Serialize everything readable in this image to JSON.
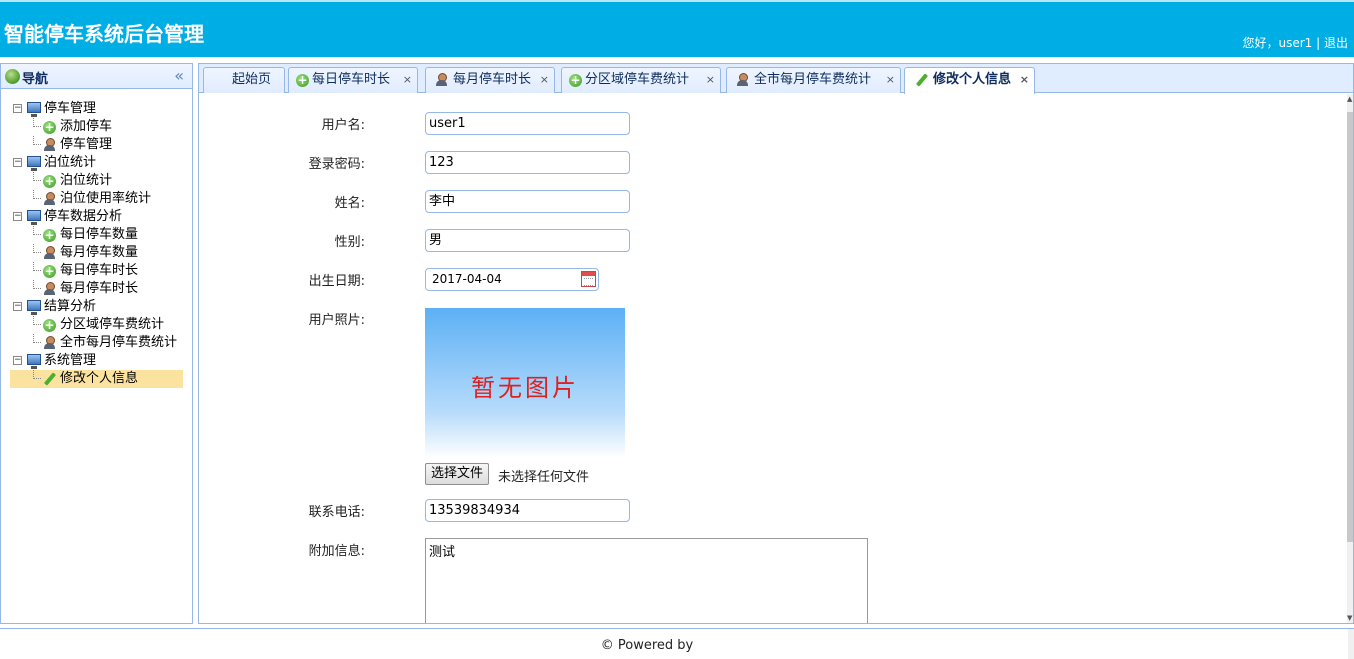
{
  "header": {
    "title": "智能停车系统后台管理",
    "greeting": "您好，user1",
    "separator": "|",
    "logout": "退出"
  },
  "nav": {
    "title": "导航",
    "collapse_glyph": "«",
    "groups": [
      {
        "label": "停车管理",
        "children": [
          {
            "label": "添加停车",
            "icon": "plus-icon"
          },
          {
            "label": "停车管理",
            "icon": "user-icon"
          }
        ]
      },
      {
        "label": "泊位统计",
        "children": [
          {
            "label": "泊位统计",
            "icon": "plus-icon"
          },
          {
            "label": "泊位使用率统计",
            "icon": "user-icon"
          }
        ]
      },
      {
        "label": "停车数据分析",
        "children": [
          {
            "label": "每日停车数量",
            "icon": "plus-icon"
          },
          {
            "label": "每月停车数量",
            "icon": "user-icon"
          },
          {
            "label": "每日停车时长",
            "icon": "plus-icon"
          },
          {
            "label": "每月停车时长",
            "icon": "user-icon"
          }
        ]
      },
      {
        "label": "结算分析",
        "children": [
          {
            "label": "分区域停车费统计",
            "icon": "plus-icon"
          },
          {
            "label": "全市每月停车费统计",
            "icon": "user-icon"
          }
        ]
      },
      {
        "label": "系统管理",
        "children": [
          {
            "label": "修改个人信息",
            "icon": "pencil-icon",
            "selected": true
          }
        ]
      }
    ]
  },
  "tabs": [
    {
      "label": "起始页",
      "closable": false
    },
    {
      "label": "每日停车时长",
      "icon": "plus-icon",
      "closable": true
    },
    {
      "label": "每月停车时长",
      "icon": "user-icon",
      "closable": true
    },
    {
      "label": "分区域停车费统计",
      "icon": "plus-icon",
      "closable": true
    },
    {
      "label": "全市每月停车费统计",
      "icon": "user-icon",
      "closable": true
    },
    {
      "label": "修改个人信息",
      "icon": "pencil-icon",
      "closable": true,
      "active": true
    }
  ],
  "tab_close_glyph": "×",
  "form": {
    "username_label": "用户名:",
    "username_value": "user1",
    "password_label": "登录密码:",
    "password_value": "123",
    "name_label": "姓名:",
    "name_value": "李中",
    "gender_label": "性别:",
    "gender_value": "男",
    "birth_label": "出生日期:",
    "birth_value": "2017-04-04",
    "photo_label": "用户照片:",
    "photo_placeholder": "暂无图片",
    "file_button": "选择文件",
    "file_status": "未选择任何文件",
    "phone_label": "联系电话:",
    "phone_value": "13539834934",
    "extra_label": "附加信息:",
    "extra_value": "测试"
  },
  "footer": {
    "powered": "© Powered by"
  }
}
